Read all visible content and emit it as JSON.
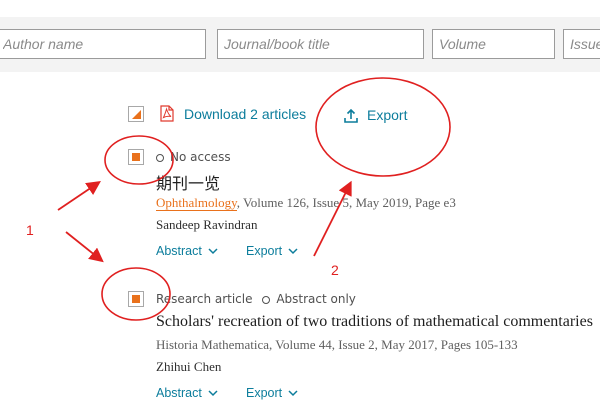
{
  "search": {
    "author_placeholder": "Author name",
    "journal_placeholder": "Journal/book title",
    "volume_placeholder": "Volume",
    "issue_placeholder": "Issue"
  },
  "toolbar": {
    "download_label": "Download 2 articles",
    "export_label": "Export"
  },
  "results": [
    {
      "access_label": "No access",
      "title": "期刊一览",
      "journal": "Ophthalmology",
      "source_rest": ", Volume 126, Issue 5, May 2019, Page e3",
      "author": "Sandeep Ravindran",
      "abstract_label": "Abstract",
      "export_label": "Export"
    },
    {
      "type_label": "Research article",
      "access_label": "Abstract only",
      "title": "Scholars' recreation of two traditions of mathematical commentaries",
      "source": "Historia Mathematica, Volume 44, Issue 2, May 2017, Pages 105-133",
      "author": "Zhihui Chen",
      "abstract_label": "Abstract",
      "export_label": "Export"
    }
  ],
  "annotations": {
    "label_1": "1",
    "label_2": "2",
    "color": "#e02020"
  },
  "colors": {
    "link": "#0c7d9c",
    "accent_orange": "#e9711c",
    "search_band": "#f3f3f3"
  }
}
